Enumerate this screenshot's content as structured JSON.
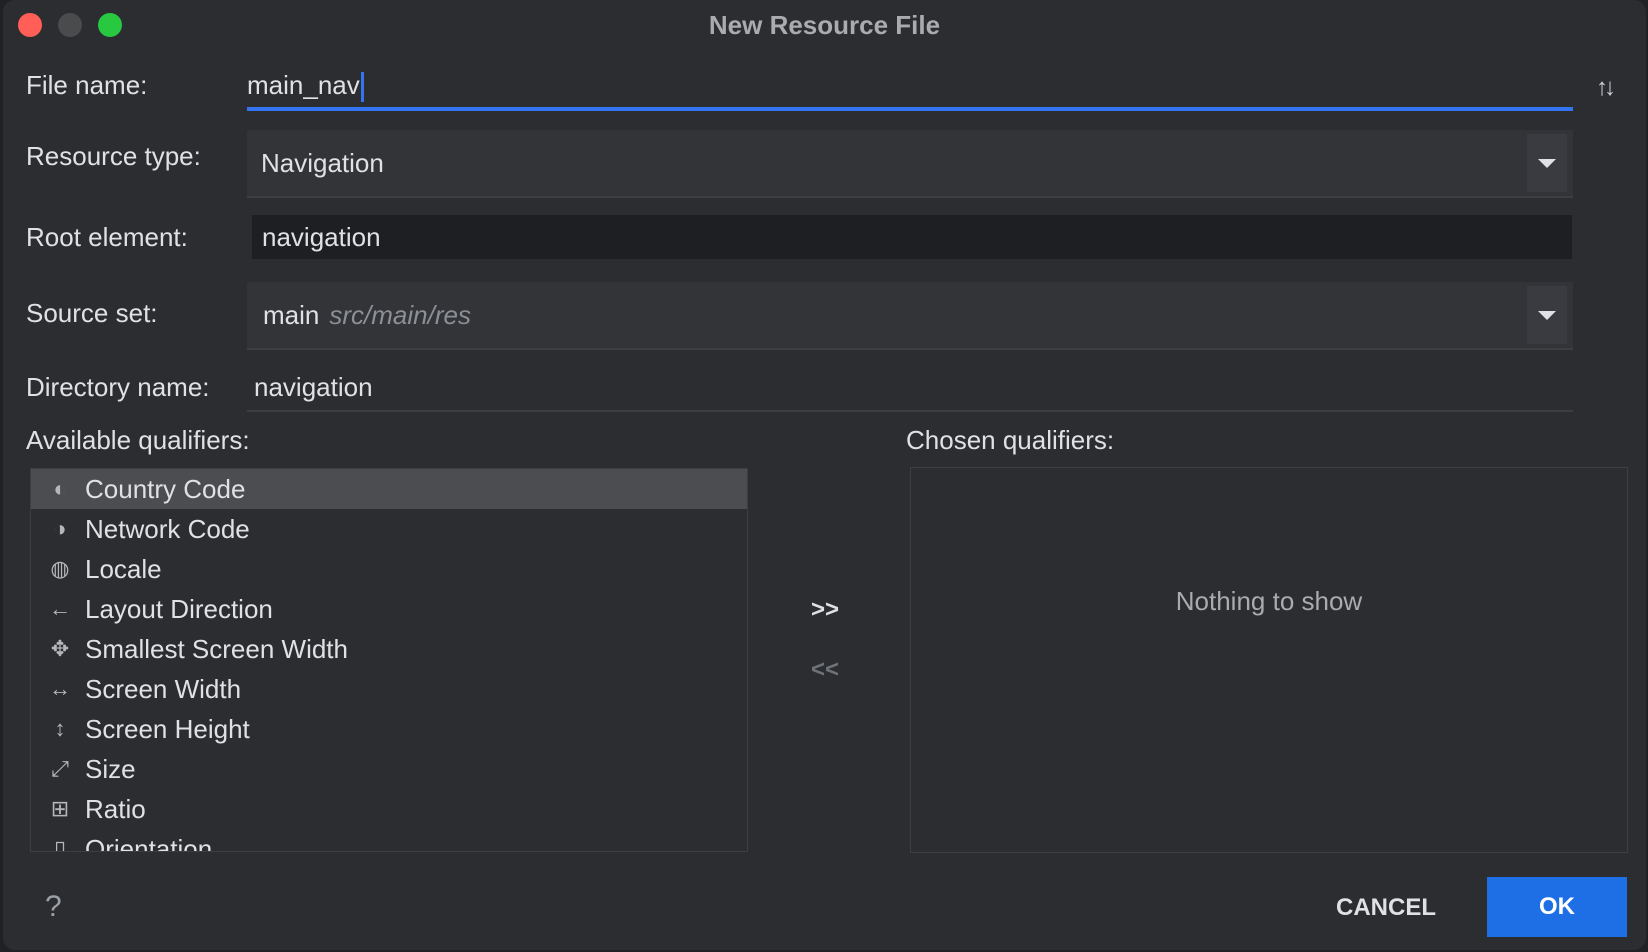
{
  "window": {
    "title": "New Resource File"
  },
  "form": {
    "file_name_label": "File name:",
    "file_name_value": "main_nav",
    "resource_type_label": "Resource type:",
    "resource_type_value": "Navigation",
    "root_element_label": "Root element:",
    "root_element_value": "navigation",
    "source_set_label": "Source set:",
    "source_set_value": "main",
    "source_set_path": "src/main/res",
    "directory_name_label": "Directory name:",
    "directory_name_value": "navigation"
  },
  "qualifiers": {
    "available_label": "Available qualifiers:",
    "chosen_label": "Chosen qualifiers:",
    "empty_text": "Nothing to show",
    "add_label": ">>",
    "remove_label": "<<",
    "items": [
      {
        "label": "Country Code",
        "icon": "country-code-icon",
        "glyph": "◐"
      },
      {
        "label": "Network Code",
        "icon": "network-code-icon",
        "glyph": "◑"
      },
      {
        "label": "Locale",
        "icon": "globe-icon",
        "glyph": "◍"
      },
      {
        "label": "Layout Direction",
        "icon": "layout-direction-icon",
        "glyph": "←"
      },
      {
        "label": "Smallest Screen Width",
        "icon": "smallest-width-icon",
        "glyph": "✥"
      },
      {
        "label": "Screen Width",
        "icon": "screen-width-icon",
        "glyph": "↔"
      },
      {
        "label": "Screen Height",
        "icon": "screen-height-icon",
        "glyph": "↕"
      },
      {
        "label": "Size",
        "icon": "size-icon",
        "glyph": "⤢"
      },
      {
        "label": "Ratio",
        "icon": "ratio-icon",
        "glyph": "⊞"
      },
      {
        "label": "Orientation",
        "icon": "orientation-icon",
        "glyph": "▯"
      }
    ]
  },
  "buttons": {
    "help_label": "?",
    "cancel_label": "CANCEL",
    "ok_label": "OK"
  },
  "colors": {
    "accent": "#3574f0",
    "ok_button": "#1e6ee6",
    "close": "#ff5f57",
    "maximize": "#28c840"
  }
}
